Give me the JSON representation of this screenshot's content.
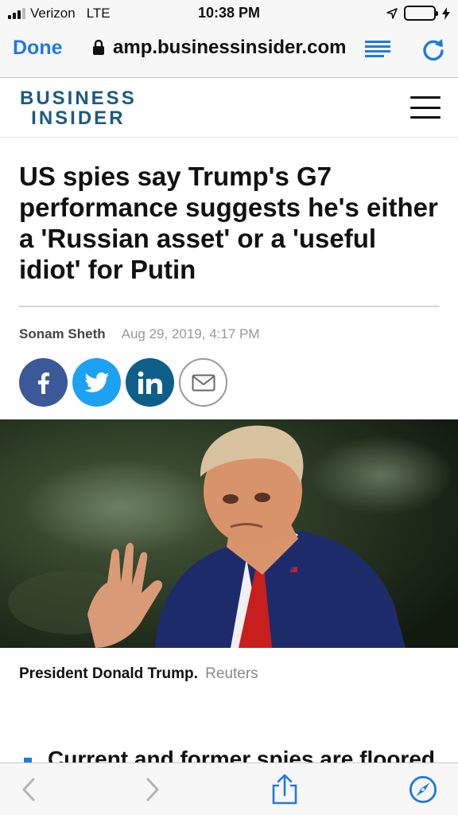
{
  "status_bar": {
    "carrier": "Verizon",
    "network": "LTE",
    "time": "10:38 PM",
    "icons": [
      "signal-icon",
      "location-arrow-icon",
      "battery-icon",
      "charging-bolt-icon"
    ]
  },
  "browser": {
    "done_label": "Done",
    "url": "amp.businessinsider.com",
    "icons": [
      "lock-icon",
      "reader-mode-icon",
      "reload-icon"
    ]
  },
  "site": {
    "logo_line1": "BUSINESS",
    "logo_line2": "INSIDER",
    "menu_icon": "hamburger-menu-icon",
    "brand_color": "#1d5a81"
  },
  "article": {
    "headline": "US spies say Trump's G7 performance suggests he's either a 'Russian asset' or a 'useful idiot' for Putin",
    "author": "Sonam Sheth",
    "date": "Aug 29, 2019, 4:17 PM",
    "share_buttons": [
      {
        "icon": "facebook-icon",
        "color": "#3b5998"
      },
      {
        "icon": "twitter-icon",
        "color": "#1da1f2"
      },
      {
        "icon": "linkedin-icon",
        "color": "#0e5e8a"
      },
      {
        "icon": "email-icon",
        "color": "#ffffff"
      }
    ],
    "photo_caption": "President Donald Trump.",
    "photo_credit": "Reuters",
    "first_bullet_peek": "Current and former spies are floored"
  },
  "toolbar": {
    "icons": [
      "back-icon",
      "forward-icon",
      "share-icon",
      "safari-compass-icon"
    ],
    "accent": "#1f7ae0"
  }
}
